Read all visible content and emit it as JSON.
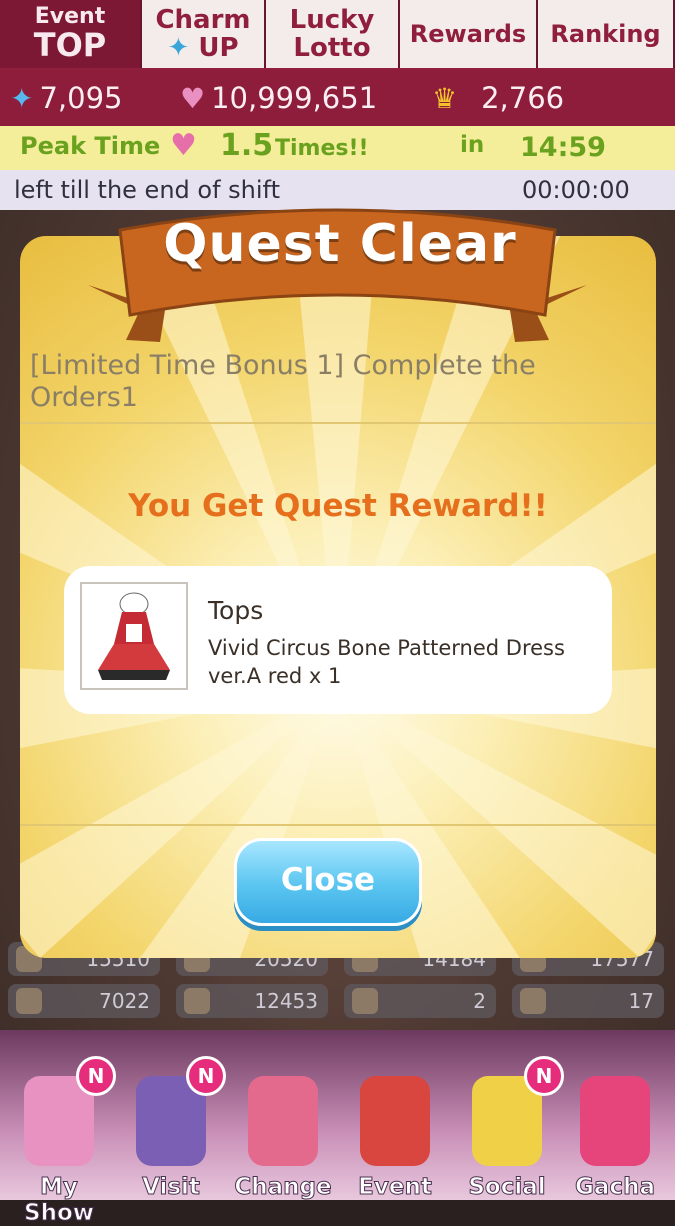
{
  "tabs": [
    {
      "line1": "Event",
      "line2": "TOP"
    },
    {
      "line1": "Charm",
      "line2": "UP"
    },
    {
      "line1": "Lucky",
      "line2": "Lotto"
    },
    {
      "label": "Rewards"
    },
    {
      "label": "Ranking"
    }
  ],
  "status": {
    "stars": "7,095",
    "charm": "10,999,651",
    "crowns": "2,766"
  },
  "peak": {
    "label": "Peak Time",
    "multiplier": "1.5",
    "times": "Times!!",
    "in": "in",
    "countdown": "14:59"
  },
  "shift": {
    "label": "left till the end of shift",
    "countdown": "00:00:00"
  },
  "background_counts": {
    "row1": [
      "15510",
      "20520",
      "14184",
      "17577"
    ],
    "row2": [
      "7022",
      "12453",
      "2",
      "17"
    ]
  },
  "modal": {
    "banner": "Quest Clear",
    "quest": "[Limited Time Bonus 1] Complete the Orders1",
    "reward_title": "You Get Quest Reward!!",
    "item_category": "Tops",
    "item_name": "Vivid Circus Bone Patterned Dress ver.A red x 1",
    "close_label": "Close"
  },
  "bottom_nav": [
    {
      "label": "My Show",
      "badge": "N"
    },
    {
      "label": "Visit",
      "badge": "N"
    },
    {
      "label": "Change",
      "badge": ""
    },
    {
      "label": "Event",
      "badge": ""
    },
    {
      "label": "Social",
      "badge": "N"
    },
    {
      "label": "Gacha",
      "badge": ""
    }
  ],
  "colors": {
    "accent": "#8f1f3d",
    "reward": "#e56f1c",
    "close_button": "#59c5f0"
  }
}
